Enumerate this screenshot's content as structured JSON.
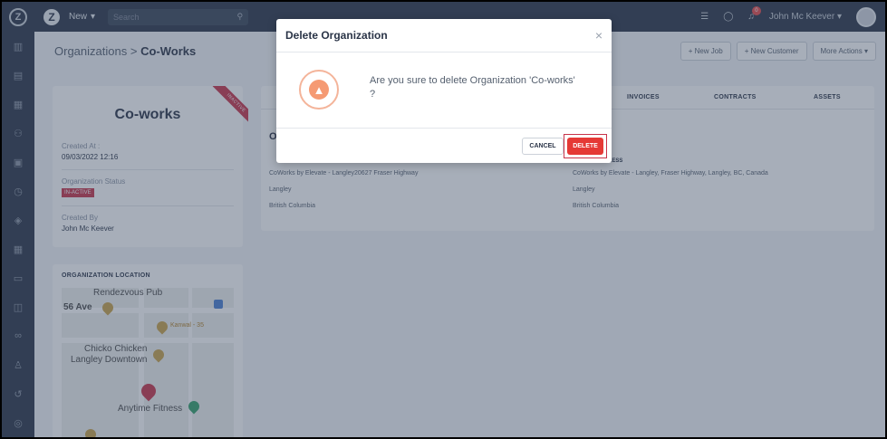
{
  "topbar": {
    "new_label": "New",
    "search_placeholder": "Search",
    "user_name": "John Mc Keever",
    "notification_count": "0"
  },
  "breadcrumb": {
    "parent": "Organizations",
    "separator": ">",
    "current": "Co-Works"
  },
  "actions": {
    "new_job": "+ New Job",
    "new_customer": "+ New Customer",
    "more_actions": "More Actions ▾"
  },
  "org": {
    "name": "Co-works",
    "ribbon": "INACTIVE",
    "created_at_label": "Created At :",
    "created_at": "09/03/2022 12:16",
    "status_label": "Organization Status",
    "status": "IN-ACTIVE",
    "created_by_label": "Created By",
    "created_by": "John Mc Keever"
  },
  "location": {
    "title": "ORGANIZATION LOCATION",
    "labels": [
      "Rendezvous Pub",
      "56 Ave",
      "Kanwal - 35",
      "Chicko Chicken",
      "Langley Downtown",
      "Anytime Fitness"
    ]
  },
  "tabs": {
    "invoices": "INVOICES",
    "contracts": "CONTRACTS",
    "assets": "ASSETS"
  },
  "address": {
    "left_heading_partial": "O",
    "left_line1": "CoWorks by Elevate - Langley20627 Fraser Highway",
    "left_line2": "Langley",
    "left_line3": "British Columbia",
    "right_heading_partial": "RESS",
    "right_line1": "CoWorks by Elevate - Langley, Fraser Highway, Langley, BC, Canada",
    "right_line2": "Langley",
    "right_line3": "British Columbia"
  },
  "modal": {
    "title": "Delete Organization",
    "close": "×",
    "message": "Are you sure to delete Organization 'Co-works' ?",
    "cancel_label": "CANCEL",
    "delete_label": "DELETE"
  },
  "colors": {
    "danger": "#e53935",
    "sidebar": "#2a3447",
    "warning": "#f59a73"
  }
}
